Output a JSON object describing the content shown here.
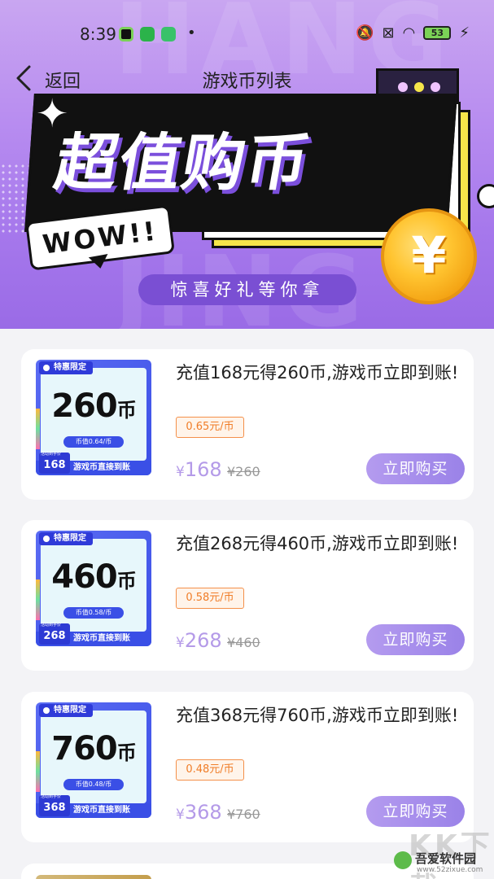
{
  "status_bar": {
    "time": "8:39",
    "battery": "53"
  },
  "nav": {
    "back_label": "返回",
    "title": "游戏币列表"
  },
  "banner": {
    "headline": "超值购币",
    "wow": "WOW!!",
    "slogan": "惊喜好礼等你拿",
    "coin_symbol": "¥",
    "bg_text_1": "HANG",
    "bg_text_2": "JING"
  },
  "products": [
    {
      "thumb_tag": "特惠限定",
      "thumb_amount": "260",
      "thumb_unit": "币",
      "thumb_rate": "币值0.64/币",
      "thumb_price": "168",
      "thumb_slogan": "游戏币直接到账",
      "title": "充值168元得260币,游戏币立即到账!",
      "rate": "0.65元/币",
      "currency": "¥",
      "price": "168",
      "old_price": "¥260",
      "button": "立即购买"
    },
    {
      "thumb_tag": "特惠限定",
      "thumb_amount": "460",
      "thumb_unit": "币",
      "thumb_rate": "币值0.58/币",
      "thumb_price": "268",
      "thumb_slogan": "游戏币直接到账",
      "title": "充值268元得460币,游戏币立即到账!",
      "rate": "0.58元/币",
      "currency": "¥",
      "price": "268",
      "old_price": "¥460",
      "button": "立即购买"
    },
    {
      "thumb_tag": "特惠限定",
      "thumb_amount": "760",
      "thumb_unit": "币",
      "thumb_rate": "币值0.48/币",
      "thumb_price": "368",
      "thumb_slogan": "游戏币直接到账",
      "title": "充值368元得760币,游戏币立即到账!",
      "rate": "0.48元/币",
      "currency": "¥",
      "price": "368",
      "old_price": "¥760",
      "button": "立即购买"
    }
  ],
  "watermark": {
    "big": "KK下载",
    "name": "吾爱软件园",
    "url": "www.52zixue.com"
  },
  "colors": {
    "accent": "#9a82e8",
    "price": "#b49ae8",
    "badge": "#f07d28",
    "banner": "#a678ec"
  }
}
